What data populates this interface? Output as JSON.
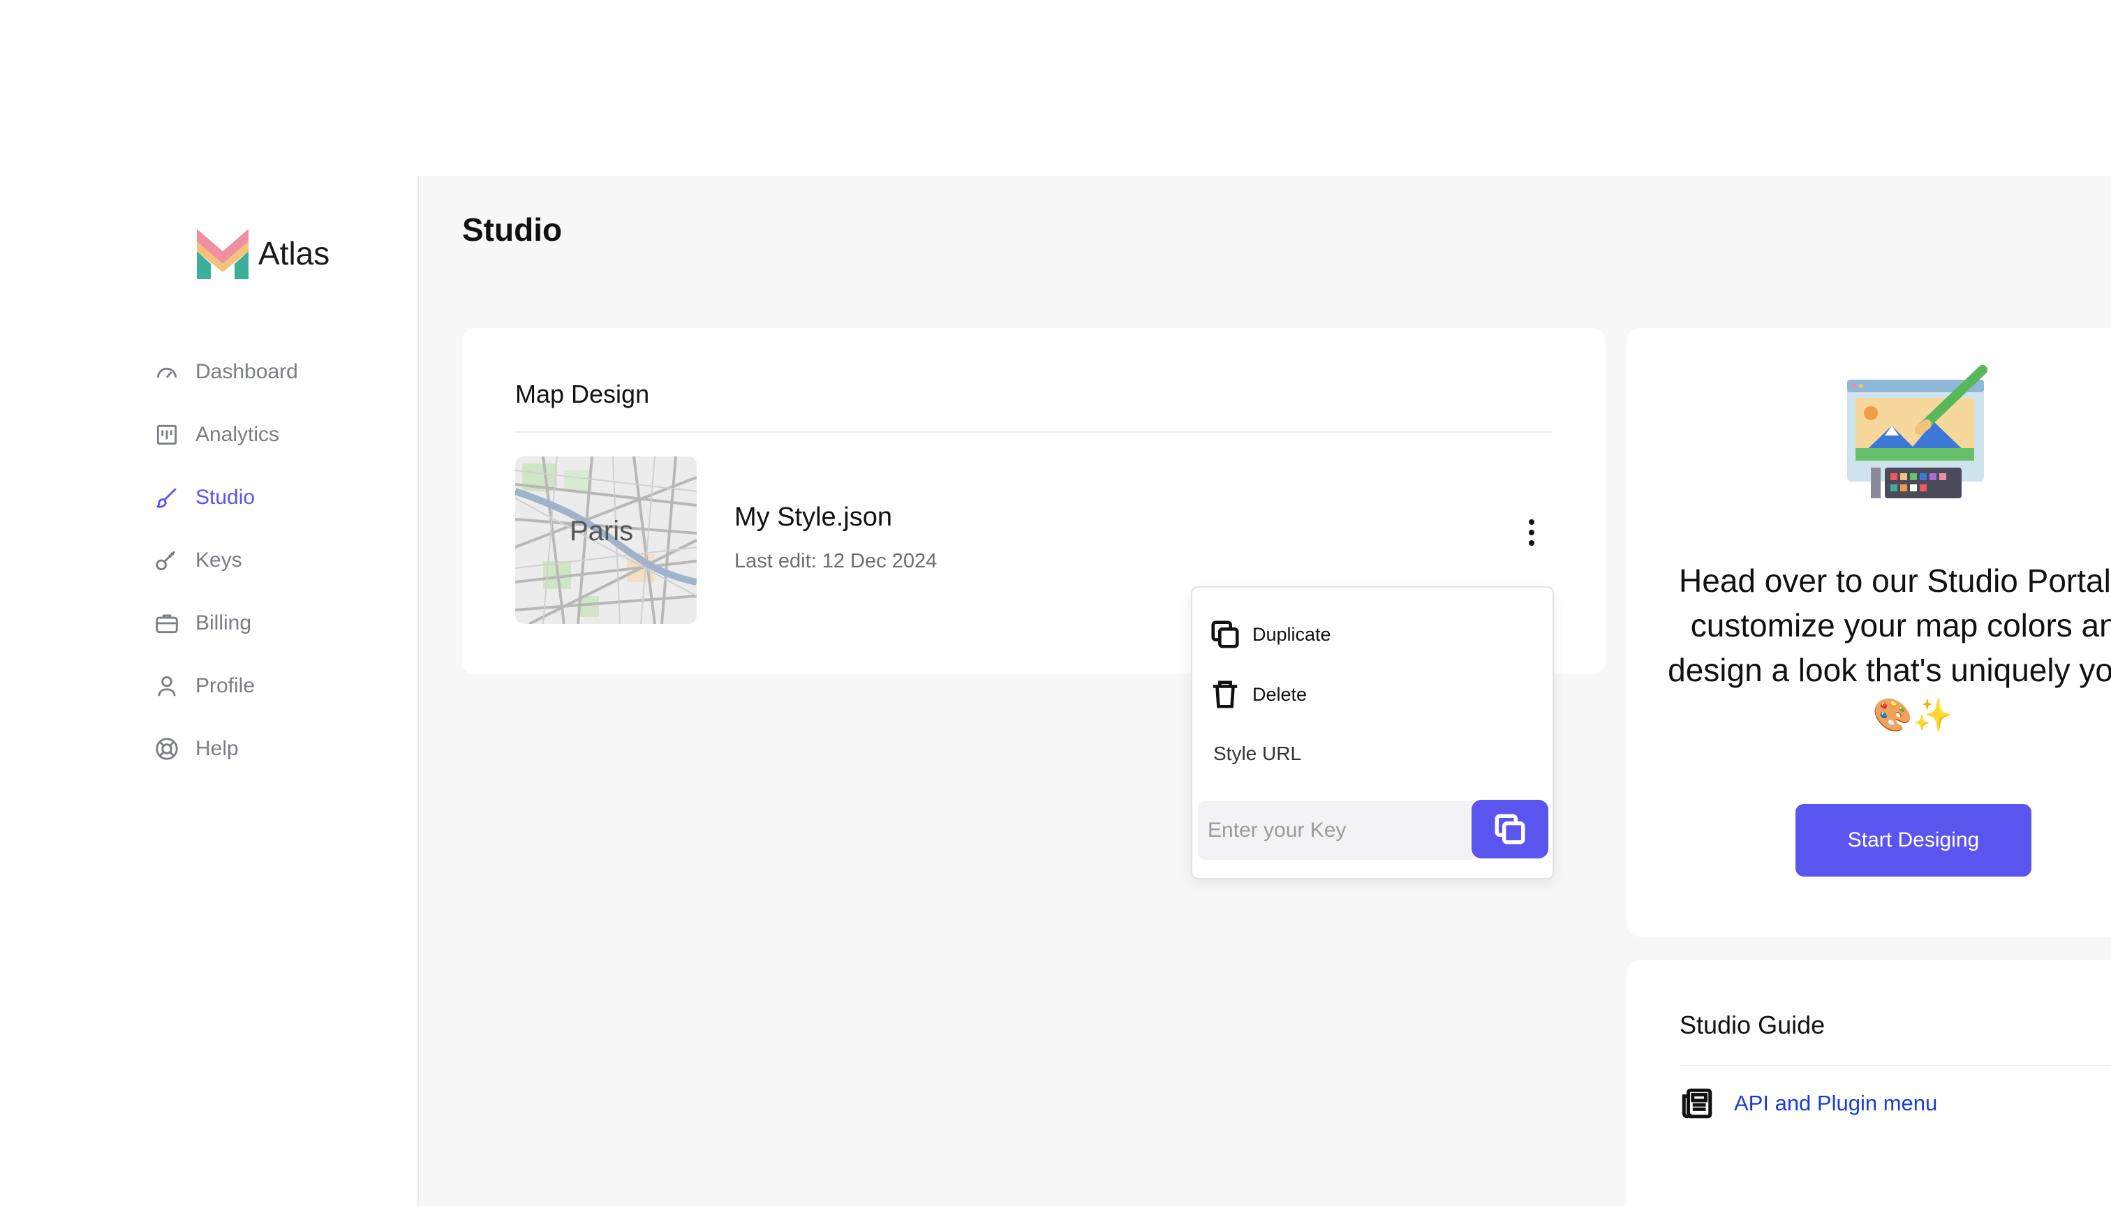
{
  "app": {
    "name": "Atlas"
  },
  "sidebar": {
    "items": [
      {
        "label": "Dashboard",
        "icon": "gauge-icon"
      },
      {
        "label": "Analytics",
        "icon": "chart-icon"
      },
      {
        "label": "Studio",
        "icon": "brush-icon",
        "active": true
      },
      {
        "label": "Keys",
        "icon": "key-icon"
      },
      {
        "label": "Billing",
        "icon": "briefcase-icon"
      },
      {
        "label": "Profile",
        "icon": "user-icon"
      },
      {
        "label": "Help",
        "icon": "lifebuoy-icon"
      }
    ]
  },
  "main": {
    "title": "Studio",
    "map_card": {
      "title": "Map Design",
      "file_name": "My Style.json",
      "last_edit": "Last edit: 12 Dec 2024",
      "thumbnail_label": "Paris"
    },
    "menu": {
      "duplicate": "Duplicate",
      "delete": "Delete",
      "style_url_label": "Style URL",
      "key_placeholder": "Enter your Key"
    },
    "promo": {
      "text": "Head over to our Studio Portal to customize your map colors and design a look that's uniquely yours 🎨✨",
      "button": "Start Desiging"
    },
    "guide": {
      "title": "Studio Guide",
      "link": "API and Plugin menu"
    }
  },
  "colors": {
    "accent": "#5a55ee",
    "link": "#1a3cd8",
    "muted": "#7a7d85"
  }
}
